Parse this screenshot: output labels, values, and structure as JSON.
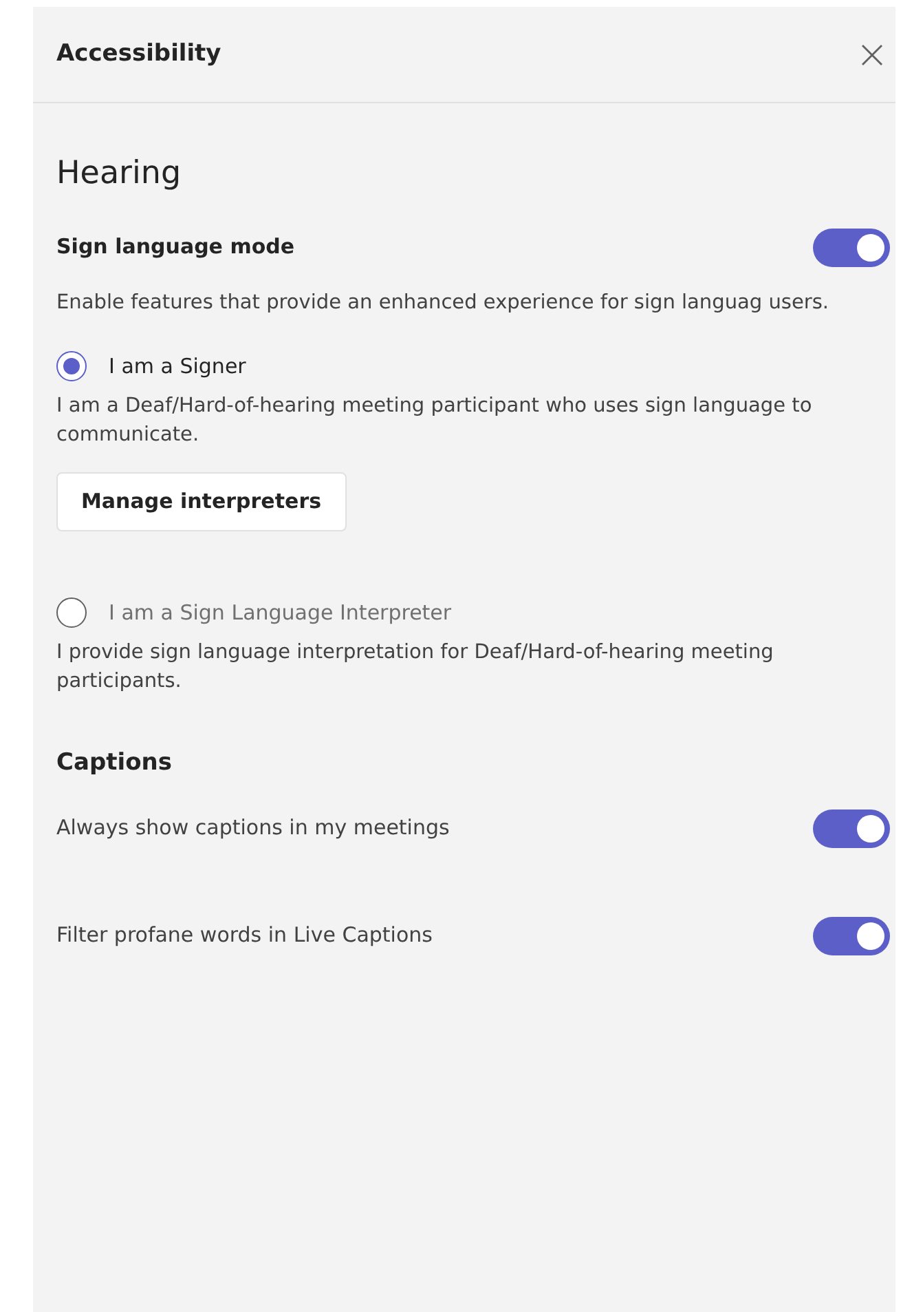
{
  "panel": {
    "title": "Accessibility"
  },
  "hearing": {
    "heading": "Hearing",
    "sign_language_mode": {
      "label": "Sign language mode",
      "on": true,
      "description": "Enable features that provide an enhanced experience for sign languag users."
    },
    "roles": [
      {
        "label": "I am a Signer",
        "selected": true,
        "description": "I am a Deaf/Hard-of-hearing meeting participant who uses sign language to communicate.",
        "button": "Manage interpreters"
      },
      {
        "label": "I am a Sign Language Interpreter",
        "selected": false,
        "description": "I provide sign language interpretation for Deaf/Hard-of-hearing meeting participants."
      }
    ]
  },
  "captions": {
    "heading": "Captions",
    "settings": [
      {
        "label": "Always show captions in my meetings",
        "on": true
      },
      {
        "label": "Filter profane words in Live Captions",
        "on": true
      }
    ]
  }
}
